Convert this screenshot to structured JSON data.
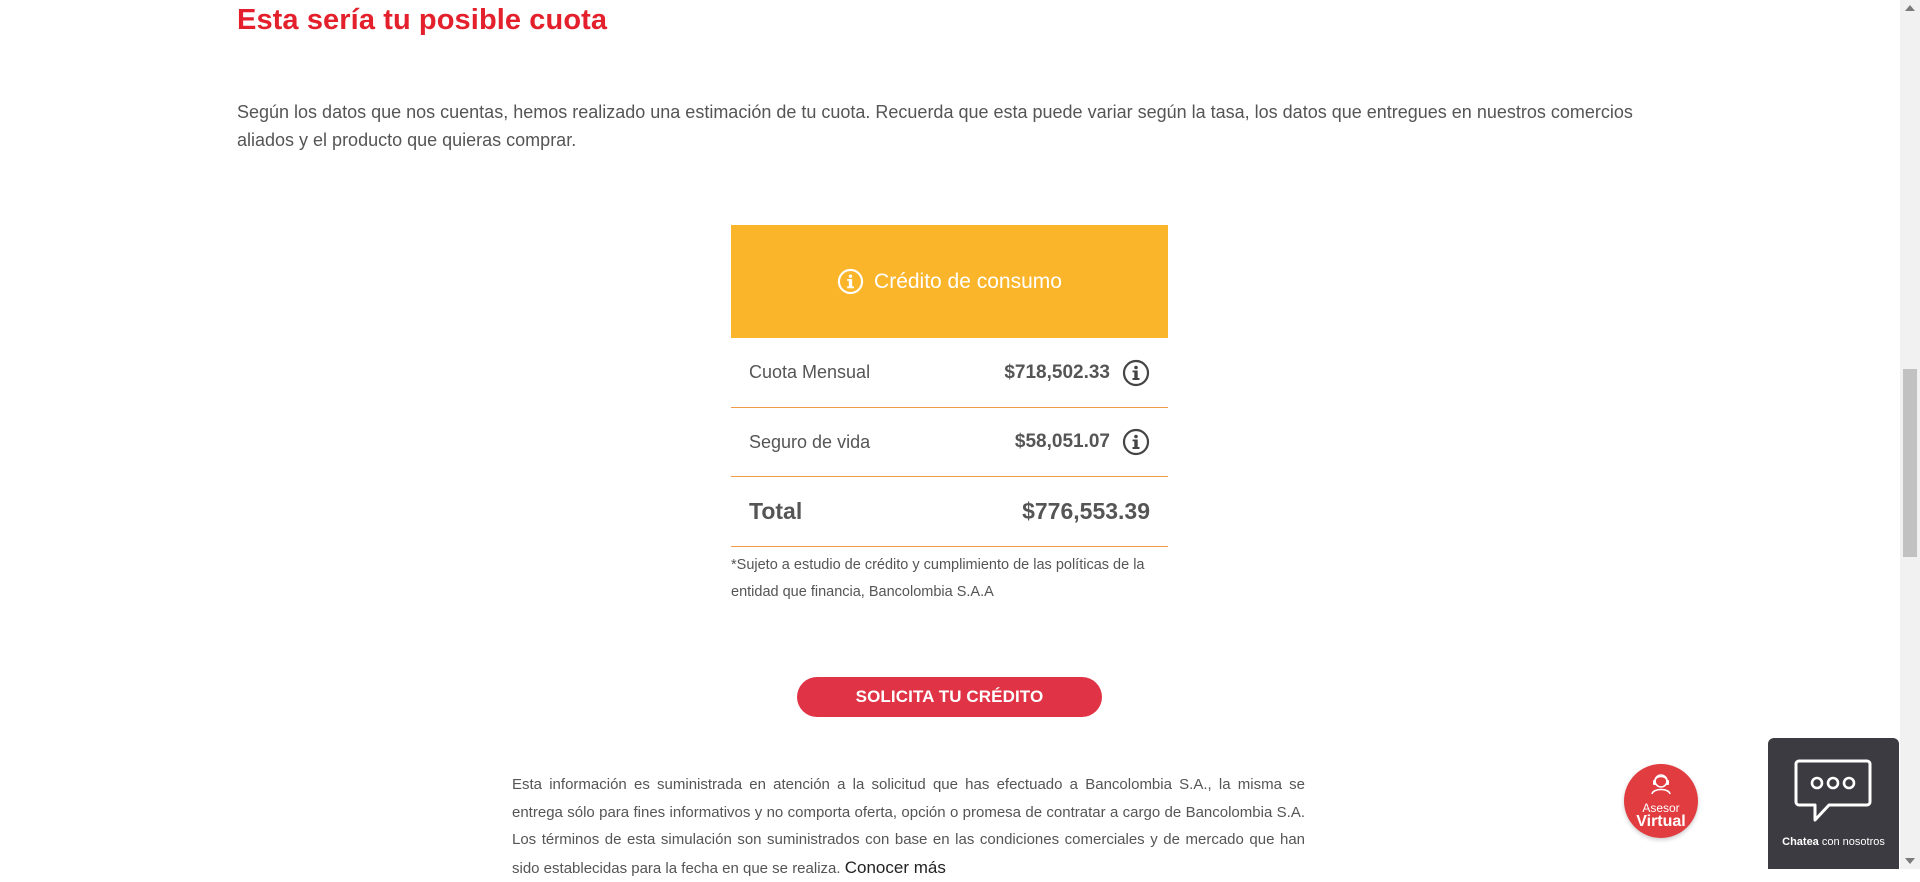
{
  "heading": "Esta sería tu posible cuota",
  "intro": "Según los datos que nos cuentas, hemos realizado una estimación de tu cuota. Recuerda que esta puede variar según la tasa, los datos que entregues en nuestros comercios aliados y el producto que quieras comprar.",
  "card": {
    "title": "Crédito de consumo",
    "rows": [
      {
        "label": "Cuota Mensual",
        "value": "$718,502.33"
      },
      {
        "label": "Seguro de vida",
        "value": "$58,051.07"
      }
    ],
    "total": {
      "label": "Total",
      "value": "$776,553.39"
    },
    "disclaimer": "*Sujeto a estudio de crédito y cumplimiento de las políticas de la entidad que financia, Bancolombia S.A.A"
  },
  "cta_label": "SOLICITA TU CRÉDITO",
  "legal": {
    "text": "Esta información es suministrada en atención a la solicitud que has efectuado a Bancolombia S.A., la misma se entrega sólo para fines informativos y no comporta oferta, opción o promesa de contratar a cargo de Bancolombia S.A. Los términos de esta simulación son suministrados con base en las condiciones comerciales y de mercado que han sido establecidas para la fecha en que se realiza.",
    "link": "Conocer más"
  },
  "assistant": {
    "line1": "Asesor",
    "line2": "Virtual"
  },
  "chat": {
    "bold": "Chatea",
    "rest": " con nosotros"
  },
  "colors": {
    "brand_red": "#e3202b",
    "card_yellow": "#fbb52b",
    "divider_orange": "#f09a4a",
    "cta_red": "#e03345",
    "chat_bg": "#3b3b41"
  },
  "icons": {
    "card_header": "info-icon",
    "row_info": "info-icon",
    "assistant": "agent-icon",
    "chat": "chat-bubble-icon"
  }
}
